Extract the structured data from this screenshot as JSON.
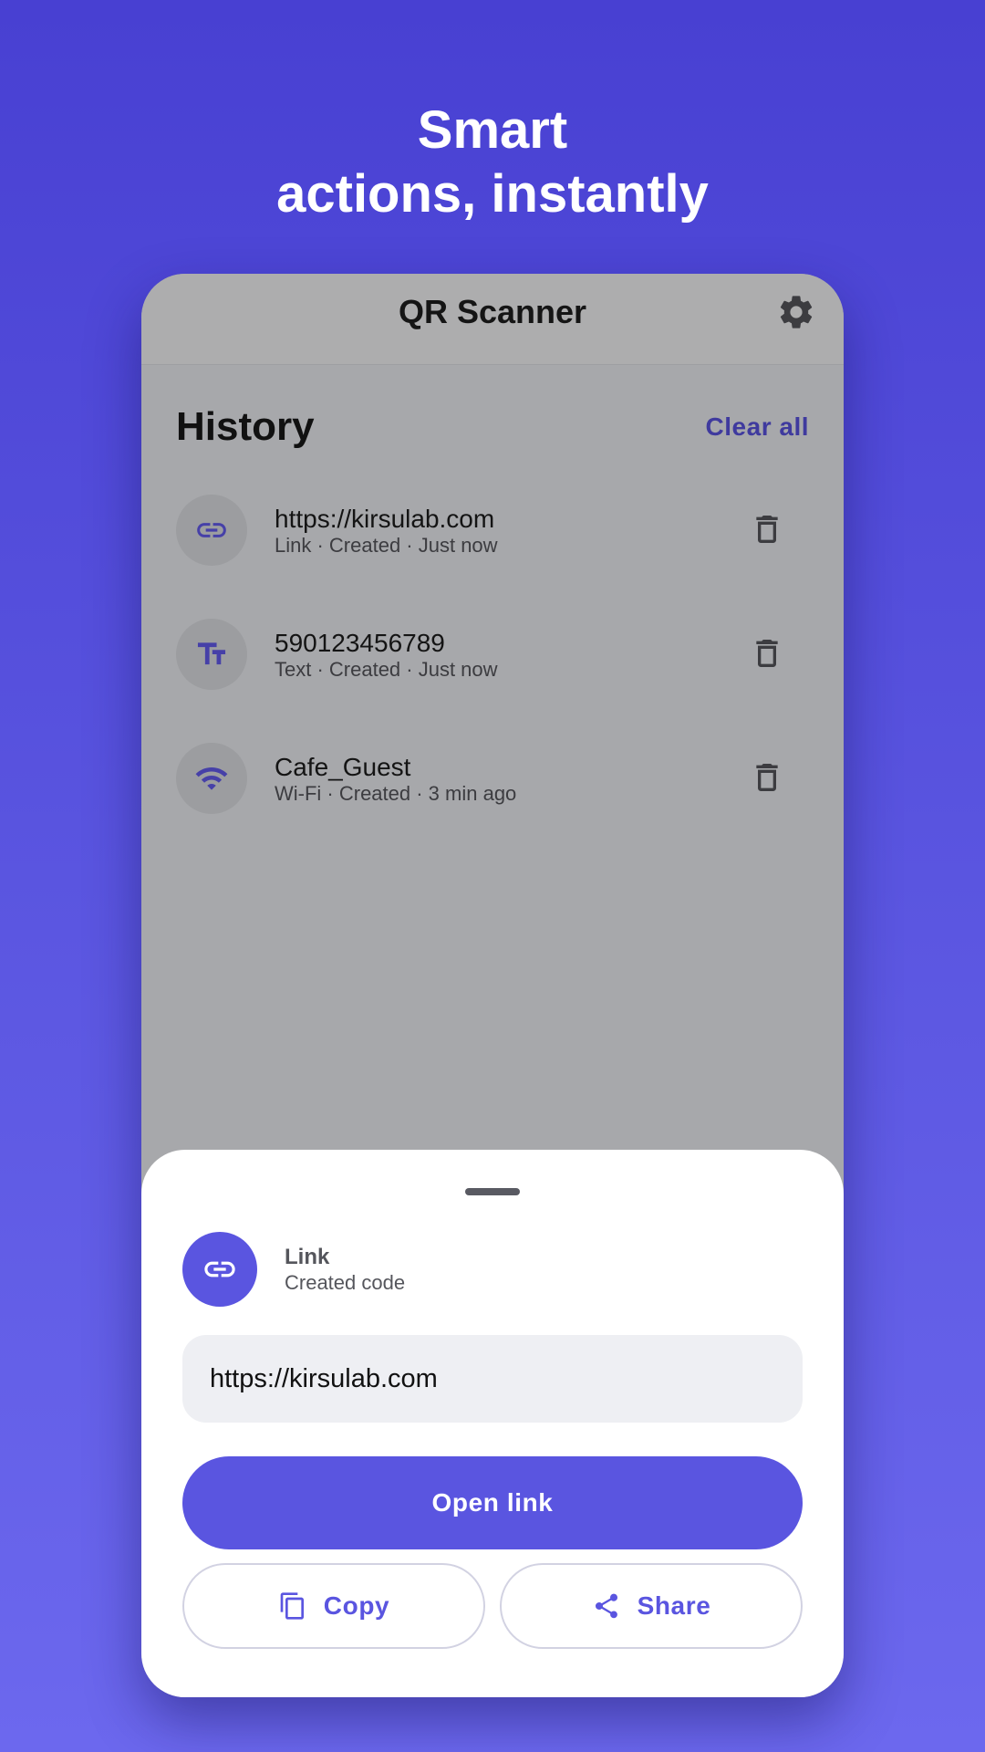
{
  "headline": {
    "line1": "Smart",
    "line2": "actions, instantly"
  },
  "app": {
    "title": "QR Scanner",
    "settings_icon": "gear-icon"
  },
  "history": {
    "title": "History",
    "clear_all": "Clear all",
    "items": [
      {
        "icon": "link-icon",
        "title": "https://kirsulab.com",
        "subtitle": "Link · Created · Just now"
      },
      {
        "icon": "text-icon",
        "title": "590123456789",
        "subtitle": "Text · Created · Just now"
      },
      {
        "icon": "wifi-icon",
        "title": "Cafe_Guest",
        "subtitle": "Wi-Fi · Created · 3 min ago"
      }
    ]
  },
  "sheet": {
    "type_icon": "link-icon",
    "type_label": "Link",
    "type_sub": "Created code",
    "content": "https://kirsulab.com",
    "primary_action": "Open link",
    "copy_label": "Copy",
    "share_label": "Share"
  },
  "colors": {
    "accent": "#5a55e0",
    "background_top": "#4840d2",
    "background_bottom": "#6c68ee",
    "scrim": "#a7a8ab",
    "clear_all": "#3f3a9e"
  }
}
